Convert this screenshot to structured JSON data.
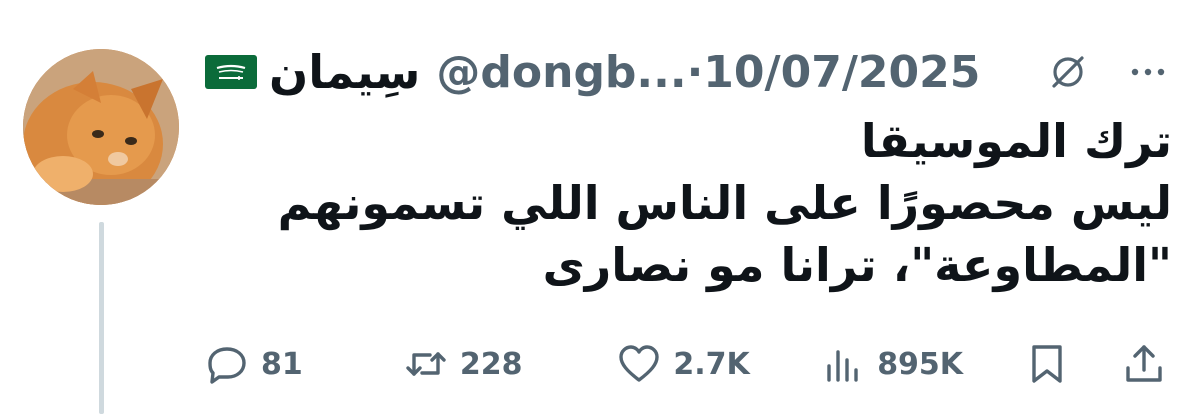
{
  "tweet": {
    "display_name": "سِيمان",
    "handle": "@dongb...",
    "separator": "·",
    "date": "10/07/2025",
    "body_lines": [
      "ترك الموسيقا",
      "ليس محصورًا على الناس اللي تسمونهم",
      "\"المطاوعة\"، ترانا مو نصارى"
    ],
    "avatar": "orange-cat-avatar",
    "flag": "saudi-arabia-flag"
  },
  "actions": {
    "reply": {
      "icon": "reply-icon",
      "count": "81"
    },
    "retweet": {
      "icon": "retweet-icon",
      "count": "228"
    },
    "like": {
      "icon": "heart-icon",
      "count": "2.7K"
    },
    "views": {
      "icon": "views-icon",
      "count": "895K"
    },
    "bookmark": {
      "icon": "bookmark-icon"
    },
    "share": {
      "icon": "share-icon"
    }
  },
  "colors": {
    "text": "#0f1419",
    "muted": "#536471",
    "thread_line": "#cfd9de",
    "flag_green": "#0b6b3a"
  }
}
